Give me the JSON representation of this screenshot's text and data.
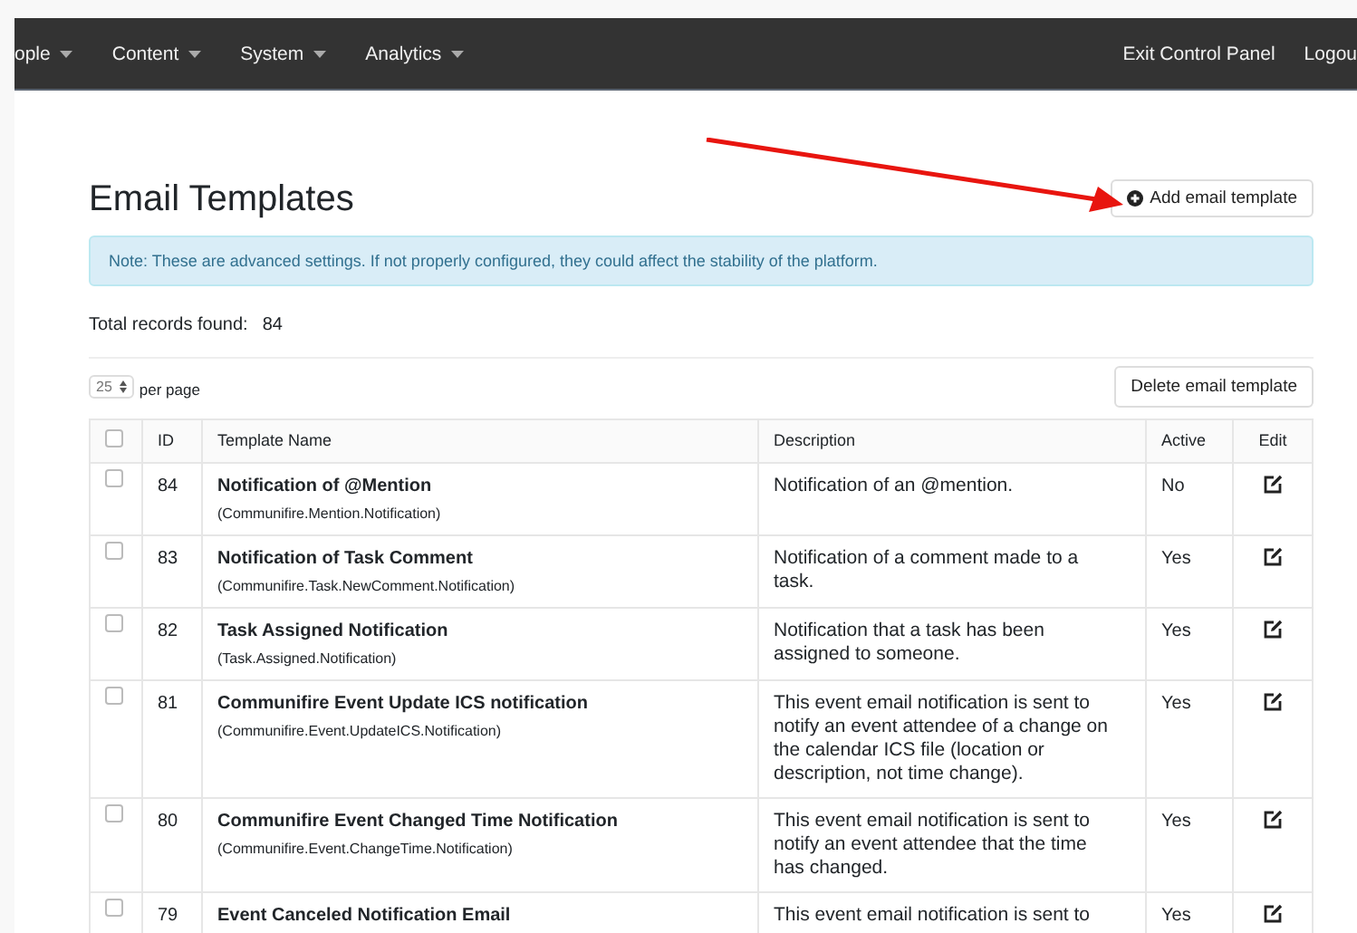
{
  "nav": {
    "left": [
      {
        "label": "ople",
        "dropdown": true
      },
      {
        "label": "Content",
        "dropdown": true
      },
      {
        "label": "System",
        "dropdown": true
      },
      {
        "label": "Analytics",
        "dropdown": true
      }
    ],
    "right": [
      {
        "label": "Exit Control Panel"
      },
      {
        "label": "Logou"
      }
    ]
  },
  "title": "Email Templates",
  "add_button": "Add email template",
  "alert": "Note: These are advanced settings. If not properly configured, they could affect the stability of the platform.",
  "total_label": "Total records found:",
  "total": "84",
  "page_size": "25",
  "per_page": "per page",
  "delete_button": "Delete email template",
  "table": {
    "columns": [
      "ID",
      "Template Name",
      "Description",
      "Active",
      "Edit"
    ],
    "rows": [
      {
        "checked": false,
        "id": "84",
        "name": "Notification of @Mention",
        "key": "(Communifire.Mention.Notification)",
        "description": "Notification of an @mention.",
        "active": "No"
      },
      {
        "checked": false,
        "id": "83",
        "name": "Notification of Task Comment",
        "key": "(Communifire.Task.NewComment.Notification)",
        "description": "Notification of a comment made to a task.",
        "active": "Yes"
      },
      {
        "checked": false,
        "id": "82",
        "name": "Task Assigned Notification",
        "key": "(Task.Assigned.Notification)",
        "description": "Notification that a task has been assigned to someone.",
        "active": "Yes"
      },
      {
        "checked": false,
        "id": "81",
        "name": "Communifire Event Update ICS notification",
        "key": "(Communifire.Event.UpdateICS.Notification)",
        "description": "This event email notification is sent to notify an event attendee of a change on the calendar ICS file (location or description, not time change).",
        "active": "Yes"
      },
      {
        "checked": false,
        "id": "80",
        "name": "Communifire Event Changed Time Notification",
        "key": "(Communifire.Event.ChangeTime.Notification)",
        "description": "This event email notification is sent to notify an event attendee that the time has changed.",
        "active": "Yes"
      },
      {
        "checked": false,
        "id": "79",
        "name": "Event Canceled Notification Email",
        "description": "This event email notification is sent to",
        "active": "Yes"
      }
    ],
    "all_checked": false
  }
}
